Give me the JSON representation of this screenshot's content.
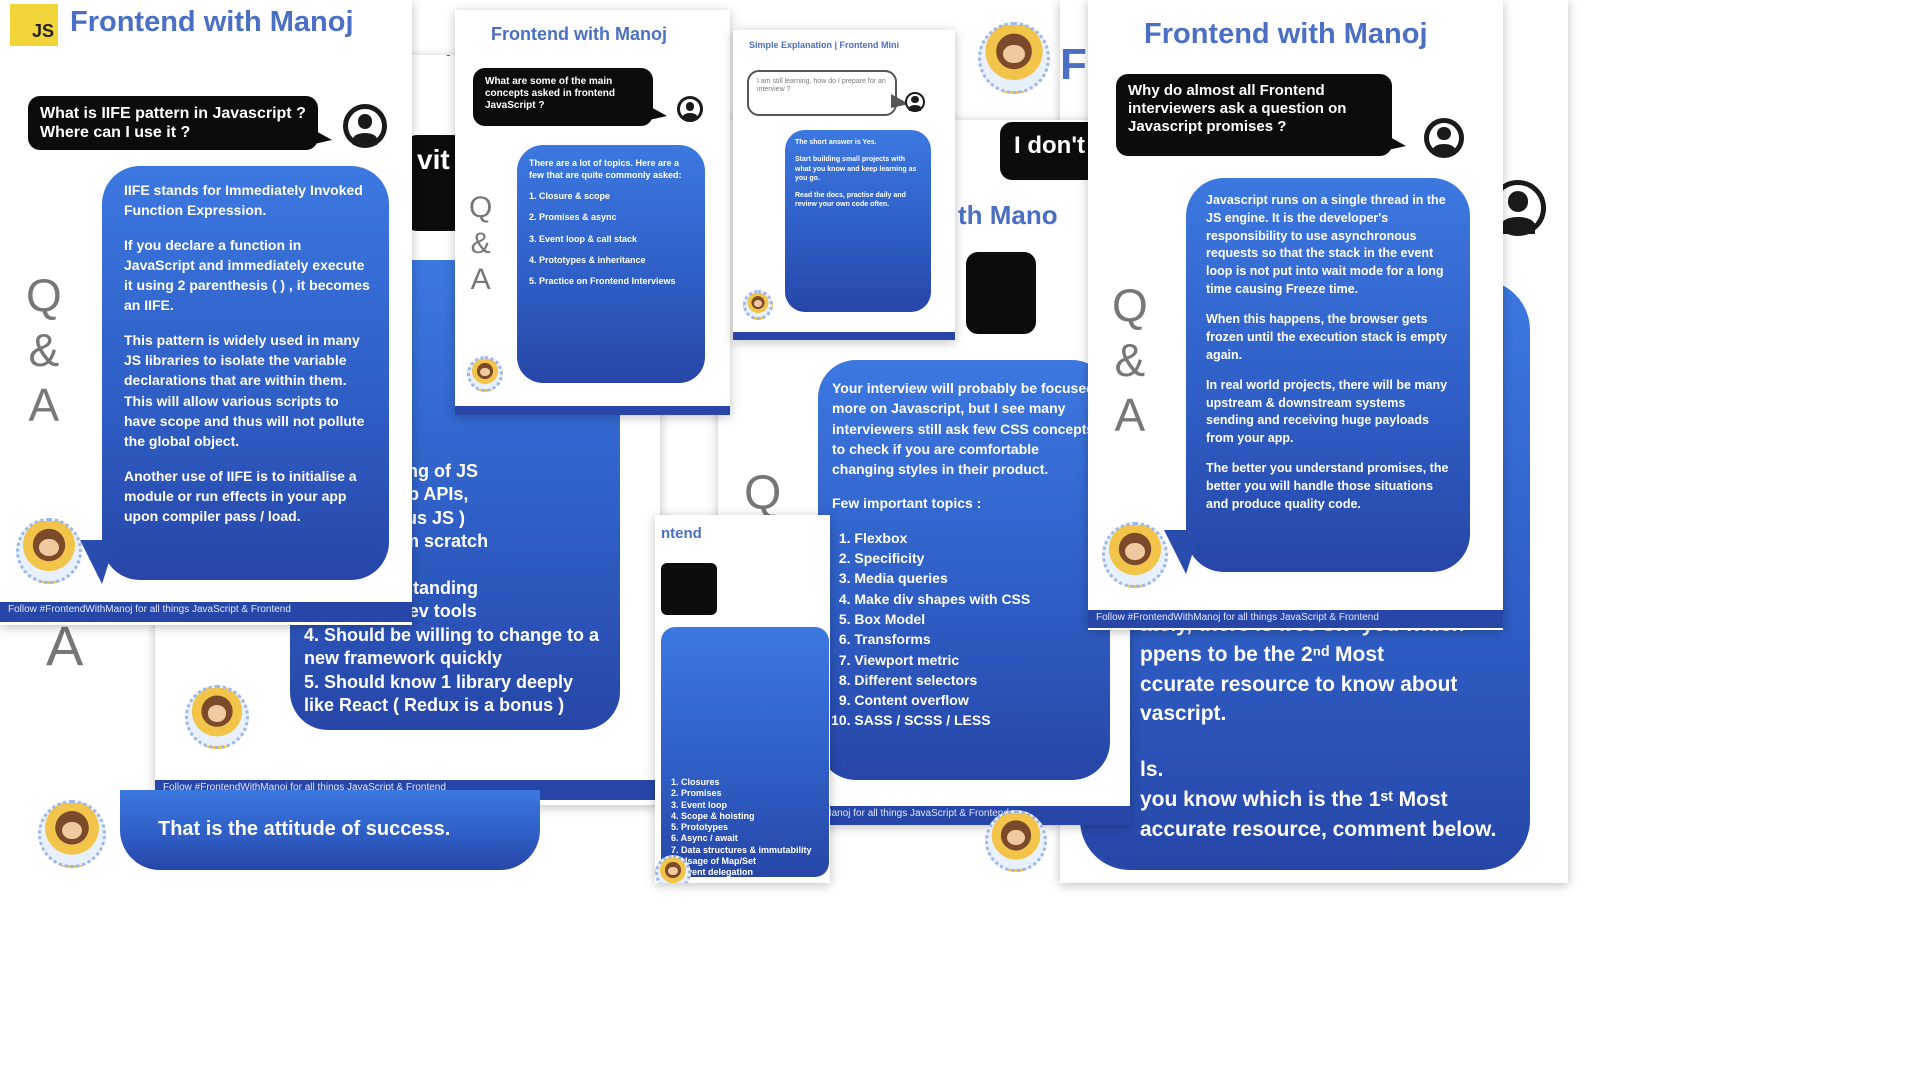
{
  "brand_title": "Frontend with Manoj",
  "qa": {
    "q": "Q",
    "amp": "&",
    "a": "A"
  },
  "footer_text": "Follow #FrontendWithManoj for all things JavaScript & Frontend",
  "logo_text": "JS",
  "card_iife": {
    "question": "What is IIFE pattern in Javascript ? Where can I use it ?",
    "answer": [
      "IIFE stands for Immediately Invoked Function Expression.",
      "If you declare a function in JavaScript and immediately execute it using 2 parenthesis ( ) , it becomes an IIFE.",
      "This pattern is widely used in many JS libraries to isolate the variable declarations that are within them. This will allow various scripts to have scope and thus will not pollute the global object.",
      "Another use of IIFE is to initialise a module or run effects in your app upon compiler pass / load."
    ]
  },
  "card_attitude": {
    "q_fragment": "vit",
    "list_fragments": [
      "understanding of JS",
      "ent loop, web APIs,",
      "asynchronous JS )",
      "projects from scratch",
      "ebpack.",
      "good understanding",
      "y, browser dev tools",
      "4. Should be willing to change to a new framework quickly",
      "5. Should know 1 library deeply like React ( Redux is a bonus )"
    ],
    "closing": "That is the attitude of success."
  },
  "card_small_topics": {
    "question": "What are some of the main concepts asked in frontend JavaScript ?",
    "answer": [
      "There are a lot of topics. Here are a few that are quite commonly asked:",
      "1. Closure & scope",
      "2. Promises & async",
      "3. Event loop & call stack",
      "4. Prototypes & inheritance",
      "5. Practice on Frontend Interviews"
    ]
  },
  "card_small_explain": {
    "header": "Simple Explanation | Frontend Mini",
    "question": "I am still learning, how do I prepare for an interview ?",
    "answer_title": "The short answer is Yes.",
    "answer": [
      "Start building small projects with what you know and keep learning as you go.",
      "Read the docs, practise daily and review your own code often."
    ]
  },
  "card_css": {
    "q_fragment": "I don't",
    "title_fragment": "th Mano",
    "answer": [
      "Your interview will probably be focused more on Javascript, but I see many interviewers still ask few CSS concepts to check if you are comfortable changing styles in their product.",
      "Few important topics :"
    ],
    "topics": [
      "Flexbox",
      "Specificity",
      "Media queries",
      "Make div shapes with CSS",
      "Box Model",
      "Transforms",
      "Viewport metric",
      "Different selectors",
      "Content overflow",
      "SASS / SCSS / LESS"
    ]
  },
  "card_small_list": {
    "title_fragment": "ntend",
    "items": [
      "1. Closures",
      "2. Promises",
      "3. Event loop",
      "4. Scope & hoisting",
      "5. Prototypes",
      "6. Async / await",
      "7. Data structures & immutability",
      "8. Usage of Map/Set",
      "9. Event delegation"
    ]
  },
  "card_promises": {
    "question": "Why do almost all Frontend interviewers ask a question on Javascript promises ?",
    "answer": [
      "Javascript runs on a single thread in the JS engine. It is the developer's responsibility to use asynchronous requests so that the stack in the event loop is not put into wait mode for a long time causing Freeze time.",
      "When this happens, the browser gets frozen until the execution stack is empty again.",
      "In real world projects, there will be many upstream & downstream systems sending and receiving huge payloads from your app.",
      "The better you understand promises, the better you will handle those situations and produce quality code."
    ]
  },
  "card_resources": {
    "lines": [
      "ately, there is free sw' you which",
      "ppens to be the 2ⁿᵈ Most",
      "ccurate resource to know about",
      "vascript.",
      "ls.",
      "you know which is the 1ˢᵗ Most",
      "accurate resource, comment below."
    ]
  }
}
